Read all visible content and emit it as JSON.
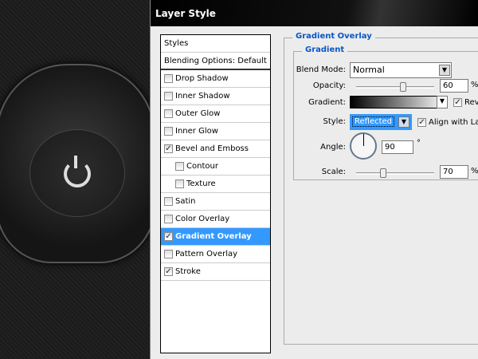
{
  "dialog": {
    "title": "Layer Style"
  },
  "list": {
    "styles": "Styles",
    "blending": "Blending Options: Default",
    "items": [
      {
        "label": "Drop Shadow",
        "checked": false
      },
      {
        "label": "Inner Shadow",
        "checked": false
      },
      {
        "label": "Outer Glow",
        "checked": false
      },
      {
        "label": "Inner Glow",
        "checked": false
      },
      {
        "label": "Bevel and Emboss",
        "checked": true
      },
      {
        "label": "Contour",
        "checked": false,
        "indent": true
      },
      {
        "label": "Texture",
        "checked": false,
        "indent": true
      },
      {
        "label": "Satin",
        "checked": false
      },
      {
        "label": "Color Overlay",
        "checked": false
      },
      {
        "label": "Gradient Overlay",
        "checked": true,
        "selected": true
      },
      {
        "label": "Pattern Overlay",
        "checked": false
      },
      {
        "label": "Stroke",
        "checked": true
      }
    ]
  },
  "panel": {
    "title": "Gradient Overlay",
    "group": "Gradient",
    "blend_label": "Blend Mode:",
    "blend_value": "Normal",
    "opacity_label": "Opacity:",
    "opacity_value": "60",
    "pct": "%",
    "opacity": 60,
    "gradient_label": "Gradient:",
    "reverse_label": "Rev",
    "style_label": "Style:",
    "style_value": "Reflected",
    "align_label": "Align with Lay",
    "angle_label": "Angle:",
    "angle_value": "90",
    "deg": "°",
    "scale_label": "Scale:",
    "scale_value": "70",
    "scale": 70
  }
}
